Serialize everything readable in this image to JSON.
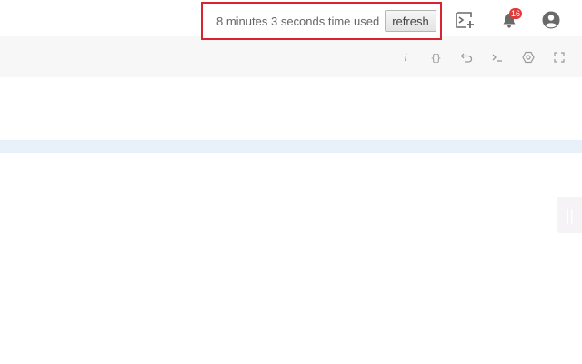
{
  "header": {
    "timer_text": "8 minutes 3 seconds time used",
    "refresh_label": "refresh",
    "notification_count": "16",
    "icons": [
      "terminal-add-icon",
      "bell-icon",
      "user-account-icon"
    ]
  },
  "toolbar": {
    "icons": [
      "info-icon",
      "braces-icon",
      "undo-icon",
      "terminal-icon",
      "settings-icon",
      "fullscreen-icon"
    ]
  },
  "colors": {
    "highlight_border": "#d9232e",
    "badge": "#e03b3b",
    "band": "#e8f1f9"
  }
}
